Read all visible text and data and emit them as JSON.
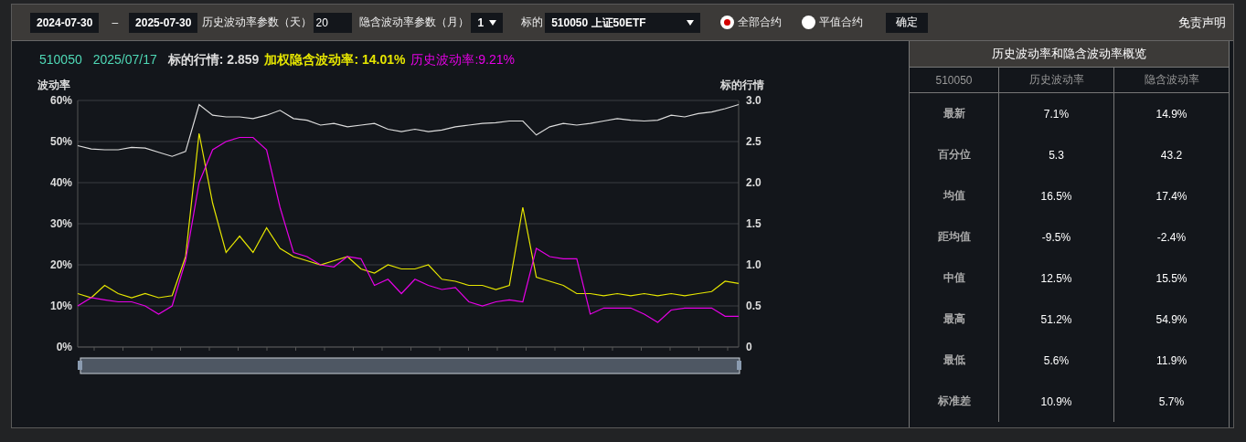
{
  "toolbar": {
    "start_date": "2024-07-30",
    "separator": "–",
    "end_date": "2025-07-30",
    "hv_param_label": "历史波动率参数（天）",
    "hv_param_value": "20",
    "iv_param_label": "隐含波动率参数（月）",
    "iv_param_value": "1",
    "underlying_label": "标的",
    "underlying_value": "510050 上证50ETF",
    "contract_options": [
      {
        "label": "全部合约",
        "selected": true
      },
      {
        "label": "平值合约",
        "selected": false
      }
    ],
    "confirm_button": "确定",
    "disclaimer_link": "免责声明"
  },
  "chart_header": {
    "code": "510050",
    "date": "2025/07/17",
    "price": "标的行情: 2.859",
    "implied_vol": "加权隐含波动率: 14.01%",
    "historical_vol": "历史波动率:9.21%"
  },
  "chart": {
    "chart_data": {
      "type": "line",
      "grid": true,
      "ylabel": "波动率",
      "ylim": [
        0,
        60
      ],
      "y2label": "标的行情",
      "y2lim": [
        0,
        3
      ],
      "y2ticks": [
        {
          "value": 0,
          "label": "0"
        },
        {
          "value": 0.5,
          "label": "0.5"
        },
        {
          "value": 1,
          "label": "1.0"
        },
        {
          "value": 1.5,
          "label": "1.5"
        },
        {
          "value": 2,
          "label": "2.0"
        },
        {
          "value": 2.5,
          "label": "2.5"
        },
        {
          "value": 3,
          "label": "3.0"
        }
      ],
      "yticks": [
        {
          "value": 0,
          "label": "0%"
        },
        {
          "value": 10,
          "label": "10%"
        },
        {
          "value": 20,
          "label": "20%"
        },
        {
          "value": 30,
          "label": "30%"
        },
        {
          "value": 40,
          "label": "40%"
        },
        {
          "value": 50,
          "label": "50%"
        },
        {
          "value": 60,
          "label": "60%"
        }
      ],
      "series": [
        {
          "color": "#dddddd",
          "axis": "y2",
          "values": [
            2.45,
            2.41,
            2.4,
            2.4,
            2.43,
            2.42,
            2.37,
            2.32,
            2.38,
            2.95,
            2.82,
            2.8,
            2.8,
            2.78,
            2.82,
            2.88,
            2.78,
            2.76,
            2.7,
            2.72,
            2.68,
            2.7,
            2.72,
            2.65,
            2.62,
            2.65,
            2.62,
            2.64,
            2.68,
            2.7,
            2.72,
            2.73,
            2.75,
            2.75,
            2.58,
            2.68,
            2.72,
            2.7,
            2.72,
            2.75,
            2.78,
            2.76,
            2.75,
            2.76,
            2.82,
            2.8,
            2.84,
            2.86,
            2.9,
            2.95
          ]
        },
        {
          "color": "#e6e600",
          "values": [
            13,
            12,
            15,
            13,
            12,
            13,
            12,
            12.5,
            22,
            52,
            35,
            23,
            27,
            23,
            29,
            24,
            22,
            21,
            20,
            21,
            22,
            19,
            18,
            20,
            19,
            19,
            20,
            16.5,
            16,
            15,
            15,
            14,
            15,
            34,
            17,
            16,
            15,
            13,
            13,
            12.5,
            13,
            12.5,
            13,
            12.5,
            13,
            12.5,
            13,
            13.5,
            16,
            15.5
          ]
        },
        {
          "color": "#e600e6",
          "values": [
            10,
            12,
            11.5,
            11,
            11,
            10,
            8,
            10,
            21,
            40,
            48,
            50,
            51,
            51,
            48,
            34,
            23,
            22,
            20,
            19.5,
            22,
            21.5,
            15,
            16.5,
            13,
            16.5,
            15,
            14,
            14.5,
            11,
            10,
            11,
            11.5,
            11,
            24,
            22,
            21.5,
            21.5,
            8,
            9.5,
            9.5,
            9.5,
            8,
            6,
            9,
            9.5,
            9.5,
            9.5,
            7.5,
            7.5
          ]
        }
      ]
    }
  },
  "summary": {
    "title": "历史波动率和隐含波动率概览",
    "columns": [
      "510050",
      "历史波动率",
      "隐含波动率"
    ],
    "rows": [
      {
        "label": "最新",
        "hv": "7.1%",
        "iv": "14.9%"
      },
      {
        "label": "百分位",
        "hv": "5.3",
        "iv": "43.2"
      },
      {
        "label": "均值",
        "hv": "16.5%",
        "iv": "17.4%"
      },
      {
        "label": "距均值",
        "hv": "-9.5%",
        "iv": "-2.4%"
      },
      {
        "label": "中值",
        "hv": "12.5%",
        "iv": "15.5%"
      },
      {
        "label": "最高",
        "hv": "51.2%",
        "iv": "54.9%"
      },
      {
        "label": "最低",
        "hv": "5.6%",
        "iv": "11.9%"
      },
      {
        "label": "标准差",
        "hv": "10.9%",
        "iv": "5.7%"
      }
    ]
  }
}
